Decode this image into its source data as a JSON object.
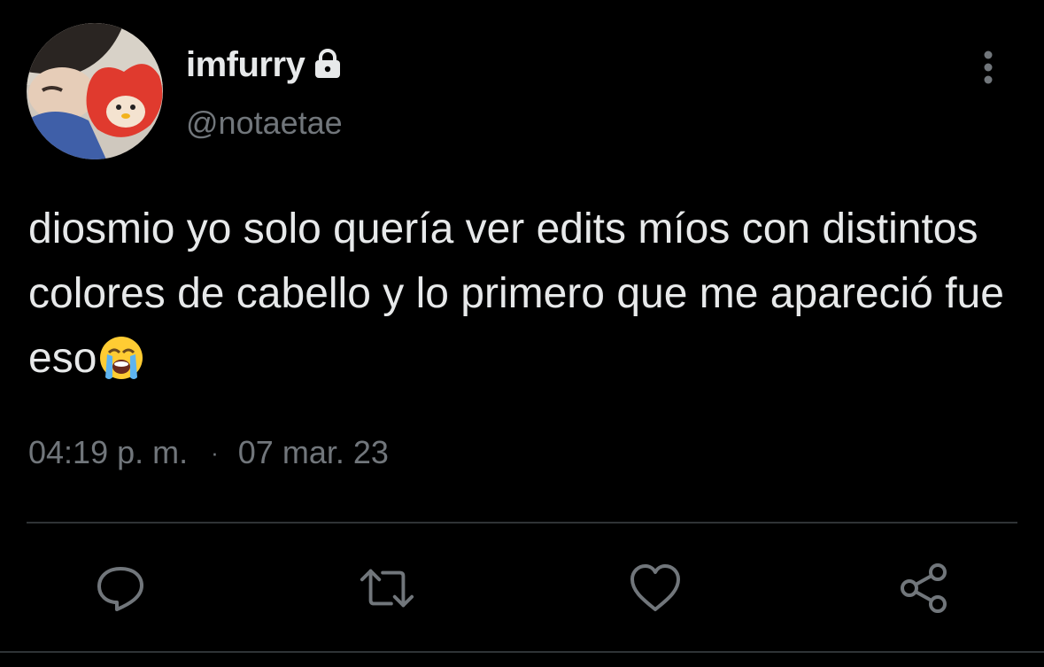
{
  "user": {
    "display_name": "imfurry",
    "handle": "@notaetae",
    "protected_icon": "lock-icon",
    "avatar": "profile-photo"
  },
  "tweet": {
    "text": "diosmio yo solo quería ver edits míos con distintos colores de cabello y lo primero que me apareció fue eso",
    "emoji": "loudly-crying-face-emoji",
    "time": "04:19 p. m.",
    "separator": "·",
    "date": "07 mar. 23"
  },
  "actions": [
    {
      "name": "reply",
      "icon": "reply-icon"
    },
    {
      "name": "retweet",
      "icon": "retweet-icon"
    },
    {
      "name": "like",
      "icon": "heart-icon"
    },
    {
      "name": "share",
      "icon": "share-icon"
    }
  ],
  "colors": {
    "background": "#000000",
    "primary_text": "#e7e9ea",
    "secondary_text": "#71767b",
    "divider": "#2f3336"
  }
}
